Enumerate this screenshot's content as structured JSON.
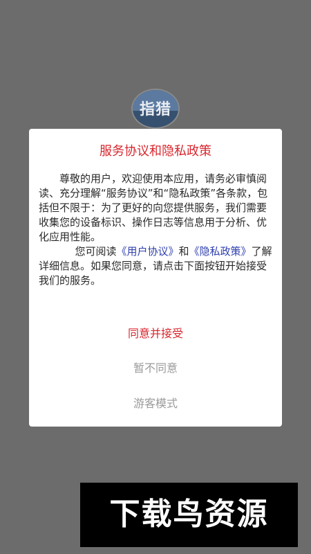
{
  "app_logo": {
    "text": "指猎"
  },
  "dialog": {
    "title": "服务协议和隐私政策",
    "paragraph1": "尊敬的用户，欢迎使用本应用，请务必审慎阅读、充分理解“服务协议”和“隐私政策”各条款，包括但不限于：为了更好的向您提供服务，我们需要收集您的设备标识、操作日志等信息用于分析、优化应用性能。",
    "paragraph2": {
      "prefix": "您可阅读",
      "user_agreement_link": "《用户协议》",
      "conjunction": "和",
      "privacy_policy_link": "《隐私政策》",
      "suffix": "了解详细信息。如果您同意，请点击下面按钮开始接受我们的服务。"
    },
    "buttons": {
      "accept": "同意并接受",
      "decline": "暂不同意",
      "guest": "游客模式"
    }
  },
  "colors": {
    "overlay": "#6c6c6c",
    "accent_red": "#d7262d",
    "link_blue": "#2f3fae",
    "muted_gray": "#9a9a9a"
  },
  "watermark": {
    "text": "下载鸟资源"
  }
}
